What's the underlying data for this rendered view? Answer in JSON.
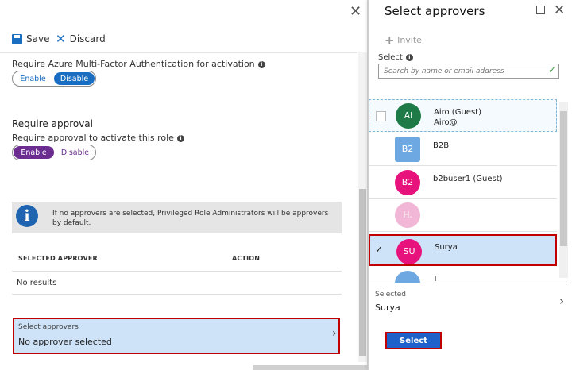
{
  "left_blade": {
    "toolbar": {
      "save_label": "Save",
      "discard_label": "Discard"
    },
    "mfa": {
      "label": "Require Azure Multi-Factor Authentication for activation",
      "options": [
        "Enable",
        "Disable"
      ],
      "selected": "Disable"
    },
    "approval": {
      "heading": "Require approval",
      "label": "Require approval to activate this role",
      "options": [
        "Enable",
        "Disable"
      ],
      "selected": "Enable"
    },
    "notice": "If no approvers are selected, Privileged Role Administrators will be approvers by default.",
    "table": {
      "columns": [
        "SELECTED APPROVER",
        "ACTION"
      ],
      "empty_text": "No results"
    },
    "select_approvers": {
      "label": "Select approvers",
      "value": "No approver selected"
    }
  },
  "right_blade": {
    "title": "Select approvers",
    "invite_label": "Invite",
    "select_label": "Select",
    "search_placeholder": "Search by name or email address",
    "users": [
      {
        "initials": "AI",
        "name": "Airo (Guest)",
        "sub": "Airo@",
        "color": "#1e7a46",
        "checked": false
      },
      {
        "initials": "B2",
        "name": "B2B",
        "sub": "",
        "color": "#6ea8e2",
        "checked": false
      },
      {
        "initials": "B2",
        "name": "b2buser1 (Guest)",
        "sub": "",
        "color": "#e8127c",
        "checked": false
      },
      {
        "initials": "H.",
        "name": "",
        "sub": "",
        "color": "#f2b6d6",
        "checked": false
      },
      {
        "initials": "SU",
        "name": "Surya",
        "sub": "",
        "color": "#e8127c",
        "checked": true
      },
      {
        "initials": "",
        "name": "T",
        "sub": "",
        "color": "#6ea8e2",
        "checked": false
      }
    ],
    "selected_section": {
      "label": "Selected",
      "value": "Surya"
    },
    "select_button": "Select"
  },
  "colors": {
    "accent": "#1a6ec2",
    "highlight_border": "#c00000",
    "approval_enable": "#6b2d8f",
    "mfa_disable": "#1a6ec2"
  }
}
